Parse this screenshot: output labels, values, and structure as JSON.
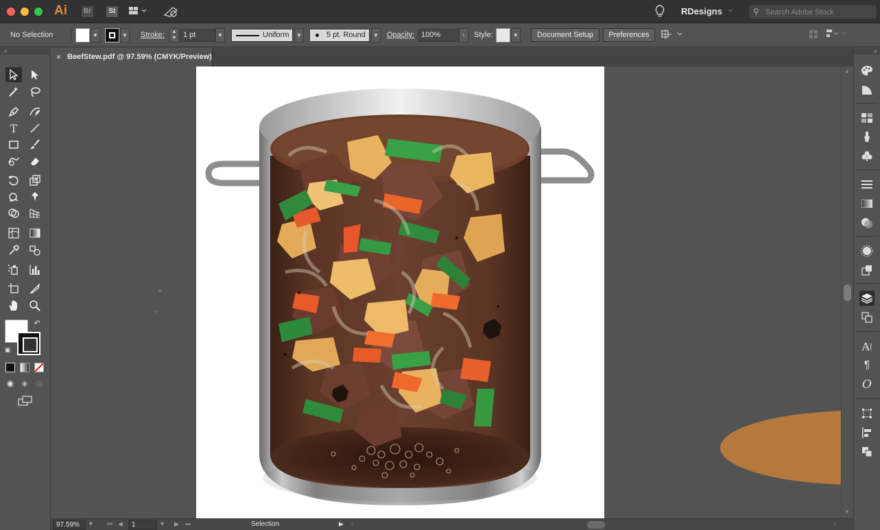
{
  "app": {
    "logo": "Ai",
    "bridge": "Br",
    "stock": "St",
    "workspace": "RDesigns",
    "search_placeholder": "Search Adobe Stock"
  },
  "control": {
    "selection_label": "No Selection",
    "stroke_label": "Stroke:",
    "stroke_weight": "1 pt",
    "stroke_profile": "Uniform",
    "brush": "5 pt. Round",
    "opacity_label": "Opacity:",
    "opacity_value": "100%",
    "style_label": "Style:",
    "document_setup": "Document Setup",
    "preferences": "Preferences"
  },
  "document": {
    "tab_title": "BeefStew.pdf @ 97.59% (CMYK/Preview)"
  },
  "status": {
    "zoom": "97.59%",
    "artboard": "1",
    "tool": "Selection"
  },
  "colors": {
    "accent_orange": "#d98b45",
    "pot_broth": "#4b2a1b",
    "stray_ellipse": "#b6793d"
  }
}
